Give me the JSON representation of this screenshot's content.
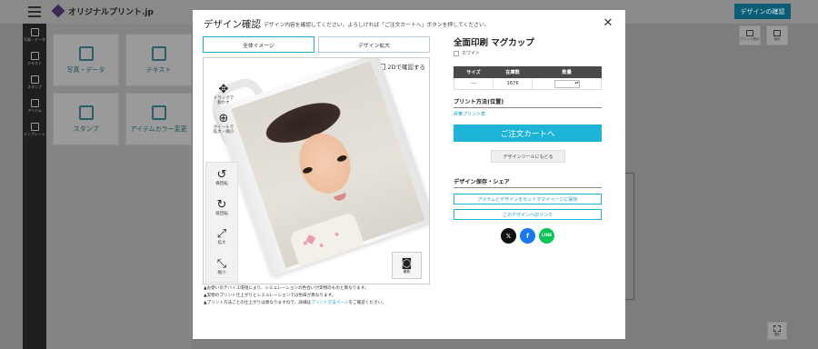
{
  "app": {
    "logo_text": "オリジナルプリント.jp",
    "confirm_button": "デザインの確認"
  },
  "left_rail": [
    {
      "label": "写真・データ",
      "icon": "image-icon"
    },
    {
      "label": "テキスト",
      "icon": "pen-icon"
    },
    {
      "label": "スタンプ",
      "icon": "stamp-icon"
    },
    {
      "label": "アイテム",
      "icon": "shirt-icon"
    },
    {
      "label": "テンプレート",
      "icon": "template-icon"
    }
  ],
  "tool_panel": [
    {
      "label": "写真・データ",
      "icon": "image-icon"
    },
    {
      "label": "テキスト",
      "icon": "pen-icon"
    },
    {
      "label": "スタンプ",
      "icon": "stamp-icon"
    },
    {
      "label": "アイテムカラー変更",
      "icon": "shirt-icon"
    }
  ],
  "right_tools": [
    {
      "label": "グリッド表示",
      "icon": "grid-icon"
    },
    {
      "label": "保存",
      "icon": "download-icon"
    }
  ],
  "bottom_tool": {
    "label": "選択",
    "icon": "select-icon"
  },
  "modal": {
    "title": "デザイン確認",
    "subtitle": "デザイン内容を確認してください。よろしければ「ご注文カートへ」ボタンを押してください。",
    "tabs": [
      "全体イメージ",
      "デザイン拡大"
    ],
    "active_tab": 0,
    "check_2d": "2Dで確認する",
    "controls": [
      {
        "label": "ドラッグで\n動かす",
        "icon": "drag-move-icon"
      },
      {
        "label": "ホイールで\n拡大・縮小",
        "icon": "mouse-wheel-icon"
      },
      {
        "label": "横回転",
        "icon": "rotate-horizontal-icon"
      },
      {
        "label": "縦回転",
        "icon": "rotate-vertical-icon"
      },
      {
        "label": "拡大",
        "icon": "zoom-in-icon"
      },
      {
        "label": "縮小",
        "icon": "zoom-out-icon"
      }
    ],
    "camera_label": "撮影",
    "notes": [
      "お使いのデバイス環境により、シミュレーションの色合いが実物のものと異なります。",
      "実物のプリント仕上がりとシミュレーションでは色味が異なります。",
      "プリント方法ごとの仕上がりは異なりますので、詳細は"
    ],
    "notes_link": "プリント方法ページ",
    "notes_tail": "をご確認ください。"
  },
  "product": {
    "title": "全面印刷 マグカップ",
    "color": "ホワイト",
    "table_headers": [
      "サイズ",
      "在庫数",
      "数量"
    ],
    "table_rows": [
      [
        "---",
        "1676",
        ""
      ]
    ],
    "print_section": "プリント方法(位置)",
    "print_method": "昇華プリント表",
    "cart_button": "ご注文カートへ",
    "back_button": "デザインツールにもどる",
    "save_section": "デザイン保存・シェア",
    "save_mypage": "アイテムとデザインをセットでマイページに保存",
    "design_link": "このデザインへのリンク",
    "share": [
      {
        "name": "x",
        "glyph": "𝕏"
      },
      {
        "name": "facebook",
        "glyph": "f"
      },
      {
        "name": "line",
        "glyph": "LINE"
      }
    ]
  }
}
